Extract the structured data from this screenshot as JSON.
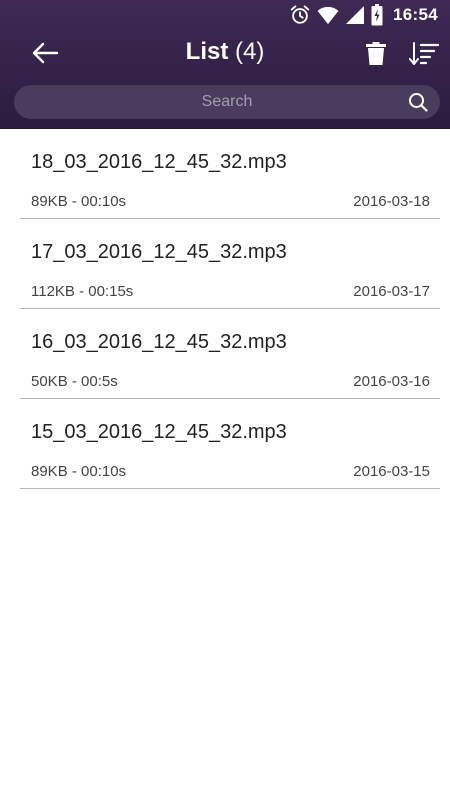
{
  "status_bar": {
    "time": "16:54",
    "icons": [
      "alarm-icon",
      "wifi-icon",
      "signal-icon",
      "battery-icon"
    ]
  },
  "app_bar": {
    "title": "List",
    "count": "(4)",
    "icons": {
      "back": "arrow-left-icon",
      "delete": "trash-icon",
      "sort": "sort-icon"
    }
  },
  "search": {
    "placeholder": "Search",
    "value": ""
  },
  "colors": {
    "header_background": "#34224a",
    "search_background": "#4a3c5c",
    "divider": "#b5b5b5"
  },
  "files": [
    {
      "name": "18_03_2016_12_45_32.mp3",
      "meta": "89KB - 00:10s",
      "date": "2016-03-18"
    },
    {
      "name": "17_03_2016_12_45_32.mp3",
      "meta": "112KB - 00:15s",
      "date": "2016-03-17"
    },
    {
      "name": "16_03_2016_12_45_32.mp3",
      "meta": "50KB - 00:5s",
      "date": "2016-03-16"
    },
    {
      "name": "15_03_2016_12_45_32.mp3",
      "meta": "89KB - 00:10s",
      "date": "2016-03-15"
    }
  ]
}
